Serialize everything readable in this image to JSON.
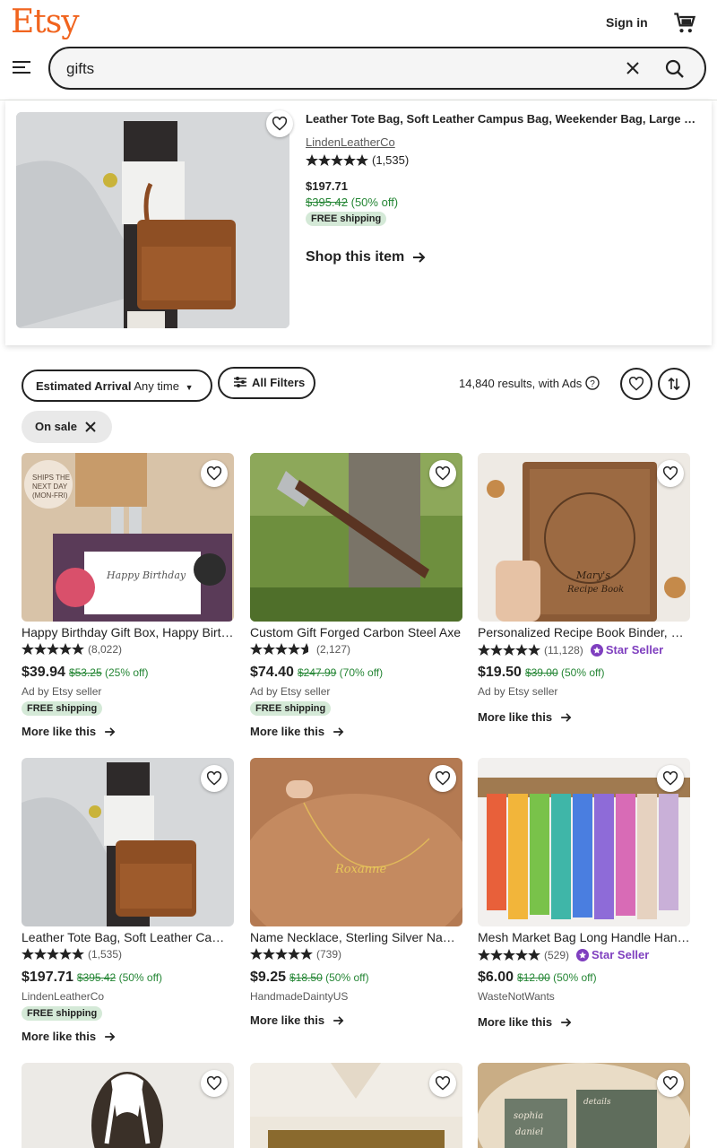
{
  "header": {
    "logo": "Etsy",
    "sign_in": "Sign in",
    "search_value": "gifts",
    "brand_color": "#f1641e"
  },
  "ad": {
    "title": "Leather Tote Bag, Soft Leather Campus Bag, Weekender Bag, Large Shoulder Bag",
    "shop": "LindenLeatherCo",
    "rating_count": "(1,535)",
    "rating": 5,
    "price": "$197.71",
    "original_price": "$395.42",
    "discount": "(50% off)",
    "shipping": "FREE shipping",
    "cta": "Shop this item"
  },
  "filters": {
    "arrival_label": "Estimated Arrival",
    "arrival_value": "Any time",
    "all_filters": "All Filters",
    "results": "14,840 results, with Ads",
    "on_sale": "On sale"
  },
  "products": [
    {
      "title": "Happy Birthday Gift Box, Happy Birthday Care Package",
      "rating": 5,
      "reviews": "(8,022)",
      "price": "$39.94",
      "original_price": "$53.25",
      "discount": "(25% off)",
      "seller": "Ad by Etsy seller",
      "shipping": "FREE shipping",
      "star_seller": "",
      "badge": "SHIPS THE NEXT DAY (MON-FRI)",
      "img_text": "Happy Birthday",
      "more": "More like this"
    },
    {
      "title": "Custom Gift Forged Carbon Steel Axe",
      "rating": 4.5,
      "reviews": "(2,127)",
      "price": "$74.40",
      "original_price": "$247.99",
      "discount": "(70% off)",
      "seller": "Ad by Etsy seller",
      "shipping": "FREE shipping",
      "star_seller": "",
      "more": "More like this"
    },
    {
      "title": "Personalized Recipe Book Binder, Wooden Recipe Book",
      "rating": 5,
      "reviews": "(11,128)",
      "price": "$19.50",
      "original_price": "$39.00",
      "discount": "(50% off)",
      "seller": "Ad by Etsy seller",
      "shipping": "",
      "star_seller": "Star Seller",
      "img_text": "Mary's Recipe Book",
      "more": "More like this"
    },
    {
      "title": "Leather Tote Bag, Soft Leather Campus Bag",
      "rating": 5,
      "reviews": "(1,535)",
      "price": "$197.71",
      "original_price": "$395.42",
      "discount": "(50% off)",
      "seller": "LindenLeatherCo",
      "shipping": "FREE shipping",
      "star_seller": "",
      "more": "More like this"
    },
    {
      "title": "Name Necklace, Sterling Silver Name Necklace",
      "rating": 5,
      "reviews": "(739)",
      "price": "$9.25",
      "original_price": "$18.50",
      "discount": "(50% off)",
      "seller": "HandmadeDaintyUS",
      "shipping": "",
      "star_seller": "",
      "img_text": "Roxanne",
      "more": "More like this"
    },
    {
      "title": "Mesh Market Bag Long Handle Handmade",
      "rating": 5,
      "reviews": "(529)",
      "price": "$6.00",
      "original_price": "$12.00",
      "discount": "(50% off)",
      "seller": "WasteNotWants",
      "shipping": "",
      "star_seller": "Star Seller",
      "more": "More like this"
    }
  ],
  "bottom_row_img_text": [
    "",
    "",
    "sophia daniel details"
  ]
}
